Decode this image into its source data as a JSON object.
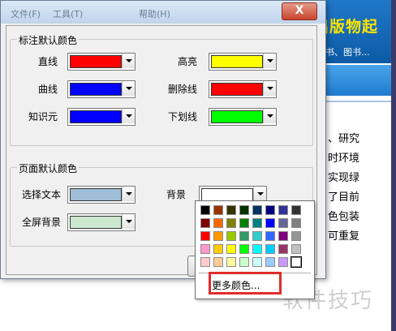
{
  "background": {
    "banner_title": "出版物起",
    "banner_subtitle": "具书、图书...",
    "lines": [
      "、研究",
      "时环境",
      "实现绿",
      "了目前",
      "色包装",
      "可重复"
    ],
    "watermark": "软件技巧"
  },
  "dialog": {
    "menu": [
      "文件(F)",
      "工具(T)",
      "帮助(H)"
    ],
    "close_label": "X",
    "annotation_group": {
      "title": "标注默认颜色",
      "items": [
        {
          "label": "直线",
          "color": "#ff0000"
        },
        {
          "label": "高亮",
          "color": "#ffff00"
        },
        {
          "label": "曲线",
          "color": "#0000ff"
        },
        {
          "label": "删除线",
          "color": "#ff0000"
        },
        {
          "label": "知识元",
          "color": "#0000ff"
        },
        {
          "label": "下划线",
          "color": "#00ff00"
        }
      ]
    },
    "page_group": {
      "title": "页面默认颜色",
      "items": [
        {
          "label": "选择文本",
          "color": "#a0bed8"
        },
        {
          "label": "背景",
          "color": "#ffffff"
        },
        {
          "label": "全屏背景",
          "color": "#cce8cf"
        }
      ]
    }
  },
  "palette": {
    "colors": [
      "#000000",
      "#993300",
      "#333300",
      "#003300",
      "#003366",
      "#000080",
      "#333399",
      "#333333",
      "#800000",
      "#ff6600",
      "#808000",
      "#008000",
      "#008080",
      "#0000ff",
      "#666699",
      "#808080",
      "#ff0000",
      "#ff9900",
      "#99cc00",
      "#339966",
      "#33cccc",
      "#3366ff",
      "#800080",
      "#969696",
      "#ff99cc",
      "#ffcc00",
      "#ffff00",
      "#00ff00",
      "#00ffff",
      "#00ccff",
      "#993366",
      "#c0c0c0",
      "#ffcccc",
      "#ffcc99",
      "#ffff99",
      "#ccffcc",
      "#ccffff",
      "#99ccff",
      "#cc99ff",
      "#ffffff"
    ],
    "selected_index": 39,
    "more_colors_label": "更多颜色..."
  },
  "colors": {
    "highlight": "#e12c2c",
    "dialog_bg": "#f0f0f0"
  }
}
